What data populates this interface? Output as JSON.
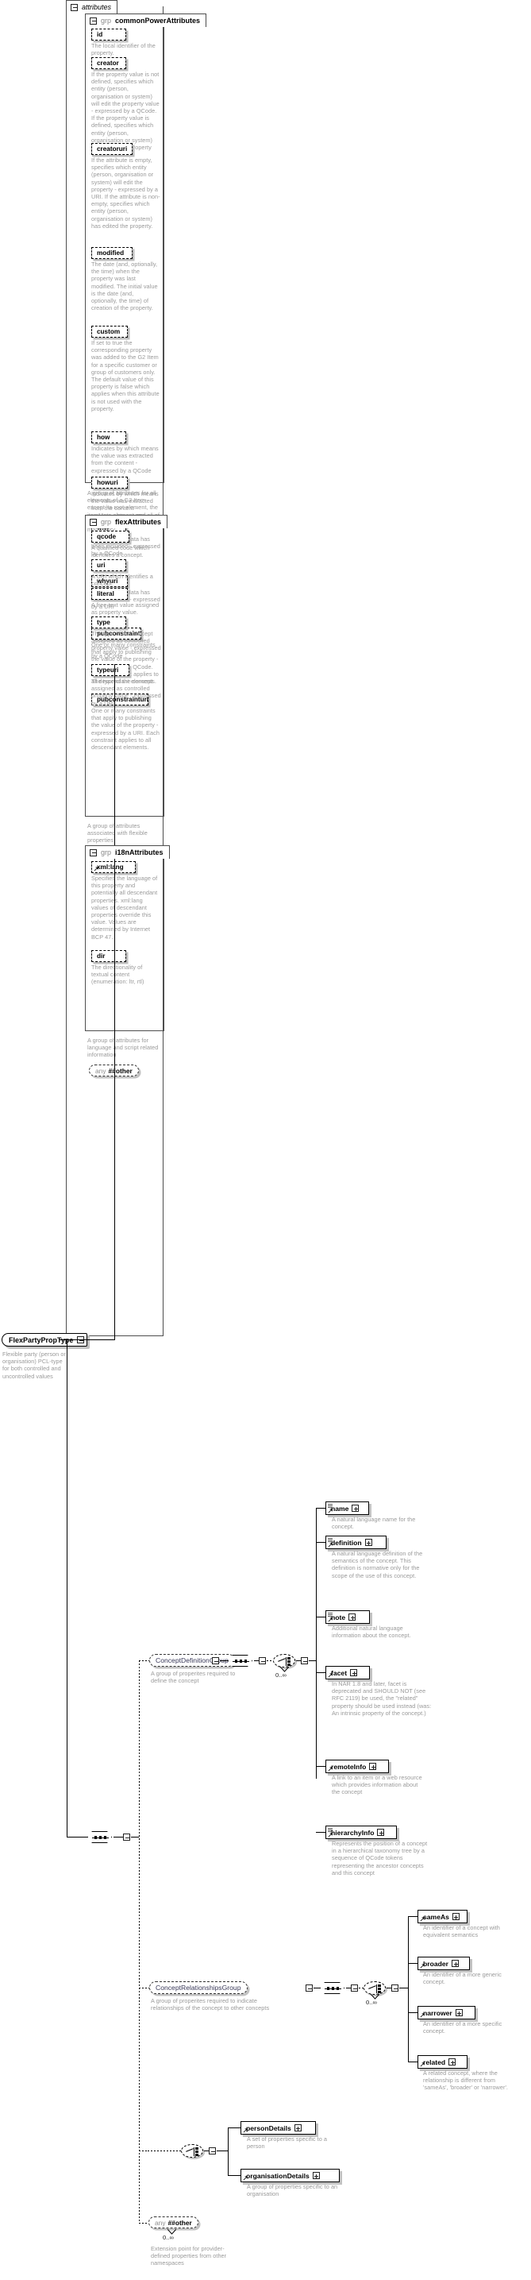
{
  "diagram": {
    "kind": "xsd-schema-documentation",
    "type_box": {
      "name": "FlexPartyPropType",
      "doc": "Flexible party (person or organisation) PCL-type for both controlled and uncontrolled values"
    },
    "attributes_panel": {
      "keyword": "",
      "title": "attributes"
    },
    "groups": [
      {
        "keyword": "grp",
        "name": "commonPowerAttributes",
        "doc": "A group of attributes for all elements of a G2 Item except its root element, the itemMeta element and all of its children which are mandatory.",
        "attributes": [
          {
            "name": "id",
            "doc": "The local identifier of the property."
          },
          {
            "name": "creator",
            "doc": "If the property value is not defined, specifies which entity (person, organisation or system) will edit the property value - expressed by a QCode. If the property value is defined, specifies which entity (person, organisation or system) has edited the property value."
          },
          {
            "name": "creatoruri",
            "doc": "If the attribute is empty, specifies which entity (person, organisation or system) will edit the property - expressed by a URI. If the attribute is non-empty, specifies which entity (person, organisation or system) has edited the property."
          },
          {
            "name": "modified",
            "doc": "The date (and, optionally, the time) when the property was last modified. The initial value is the date (and, optionally, the time) of creation of the property."
          },
          {
            "name": "custom",
            "doc": "If set to true the corresponding property was added to the G2 Item for a specific customer or group of customers only. The default value of this property is false which applies when this attribute is not used with the property."
          },
          {
            "name": "how",
            "doc": "Indicates by which means the value was extracted from the content - expressed by a QCode"
          },
          {
            "name": "howuri",
            "doc": "Indicates by which means the value was extracted from the content - expressed by a URI"
          },
          {
            "name": "why",
            "doc": "Why the metadata has been included - expressed by a QCode"
          },
          {
            "name": "whyuri",
            "doc": "Why the metadata has been included - expressed by a URI"
          },
          {
            "name": "pubconstraint",
            "doc": "One or many constraints that apply to publishing the value of the property - expressed by a QCode. Each constraint applies to all descendant elements."
          },
          {
            "name": "pubconstrainturi",
            "doc": "One or many constraints that apply to publishing the value of the property - expressed by a URI. Each constraint applies to all descendant elements."
          }
        ]
      },
      {
        "keyword": "grp",
        "name": "flexAttributes",
        "doc": "A group of attributes associated with flexible properties",
        "attributes": [
          {
            "name": "qcode",
            "doc": "A qualified code which identifies a concept."
          },
          {
            "name": "uri",
            "doc": "A URI which identifies a concept."
          },
          {
            "name": "literal",
            "doc": "A free-text value assigned as property value."
          },
          {
            "name": "type",
            "doc": "The type of the concept assigned as controlled property value - expressed by a QCode"
          },
          {
            "name": "typeuri",
            "doc": "The type of the concept assigned as controlled property value - expressed by a URI"
          }
        ]
      },
      {
        "keyword": "grp",
        "name": "i18nAttributes",
        "doc": "A group of attributes for language and script related information",
        "attributes": [
          {
            "name": "xml:lang",
            "doc": "Specifies the language of this property and potentially all descendant properties. xml:lang values of descendant properties override this value. Values are determined by Internet BCP 47."
          },
          {
            "name": "dir",
            "doc": "The directionality of textual content (enumeration: ltr, rtl)"
          }
        ]
      }
    ],
    "any_attribute": {
      "keyword": "any",
      "namespace": "##other"
    },
    "element_groups": [
      {
        "name": "ConceptDefinitionGroup",
        "doc": "A group of properites required to define the concept",
        "cardinality": "0..∞",
        "children": [
          {
            "name": "name",
            "doc": "A natural language name for the concept.",
            "hasdoc": true
          },
          {
            "name": "definition",
            "doc": "A natural language definition of the semantics of the concept. This definition is normative only for the scope of the use of this concept.",
            "hasdoc": true
          },
          {
            "name": "note",
            "doc": "Additional natural language information about the concept.",
            "hasdoc": true
          },
          {
            "name": "facet",
            "doc": "In NAR 1.8 and later, facet is deprecated and SHOULD NOT (see RFC 2119) be used, the \"related\" property should be used instead (was: An intrinsic property of the concept.)",
            "hasdoc": false
          },
          {
            "name": "remoteInfo",
            "doc": "A link to an item or a web resource which provides information about the concept",
            "hasdoc": false
          },
          {
            "name": "hierarchyInfo",
            "doc": "Represents the position of a concept in a hierarchical taxonomy tree by a sequence of QCode tokens representing the ancestor concepts and this concept",
            "hasdoc": true
          }
        ]
      },
      {
        "name": "ConceptRelationshipsGroup",
        "doc": "A group of properites required to indicate relationships of the concept to other concepts",
        "cardinality": "0..∞",
        "children": [
          {
            "name": "sameAs",
            "doc": "An identifier of a concept with equivalent semantics",
            "hasdoc": false
          },
          {
            "name": "broader",
            "doc": "An identifier of a more generic concept.",
            "hasdoc": false
          },
          {
            "name": "narrower",
            "doc": "An identifier of a more specific concept.",
            "hasdoc": false
          },
          {
            "name": "related",
            "doc": "A related concept, where the relationship is different from 'sameAs', 'broader' or 'narrower'.",
            "hasdoc": false
          }
        ]
      },
      {
        "name": "",
        "doc": "",
        "cardinality": "",
        "children": [
          {
            "name": "personDetails",
            "doc": "A set of properties specific to a person",
            "hasdoc": false
          },
          {
            "name": "organisationDetails",
            "doc": "A group of properties specific to an organisation",
            "hasdoc": false
          }
        ]
      }
    ],
    "any_element": {
      "keyword": "any",
      "namespace": "##other",
      "cardinality": "0..∞",
      "doc": "Extension point for provider-defined properties from other namespaces"
    }
  }
}
